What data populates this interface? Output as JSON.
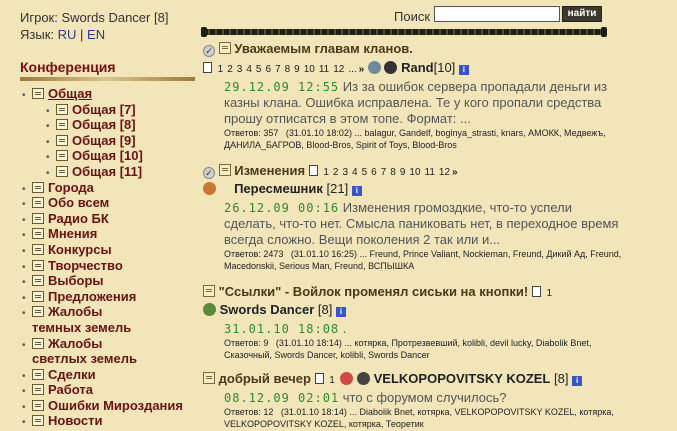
{
  "sidebar": {
    "player_label": "Игрок:",
    "player_name": "Swords Dancer",
    "player_level": "[8]",
    "lang_label": "Язык:",
    "lang_ru": "RU",
    "lang_sep": "|",
    "lang_en": "EN",
    "conference_title": "Конференция",
    "items": [
      {
        "label": "Общая"
      },
      {
        "label": "Общая [7]"
      },
      {
        "label": "Общая [8]"
      },
      {
        "label": "Общая [9]"
      },
      {
        "label": "Общая [10]"
      },
      {
        "label": "Общая [11]"
      },
      {
        "label": "Города"
      },
      {
        "label": "Обо всем"
      },
      {
        "label": "Радио БК"
      },
      {
        "label": "Мнения"
      },
      {
        "label": "Конкурсы"
      },
      {
        "label": "Творчество"
      },
      {
        "label": "Выборы"
      },
      {
        "label": "Предложения"
      },
      {
        "label": "Жалобы"
      },
      {
        "label": "темных земель"
      },
      {
        "label": "Жалобы"
      },
      {
        "label": "светлых земель"
      },
      {
        "label": "Сделки"
      },
      {
        "label": "Работа"
      },
      {
        "label": "Ошибки Мироздания"
      },
      {
        "label": "Новости"
      }
    ]
  },
  "search": {
    "label": "Поиск",
    "value": "",
    "button": "найти"
  },
  "topics": [
    {
      "title": "Уважаемым главам кланов.",
      "pages": [
        "1",
        "2",
        "3",
        "4",
        "5",
        "6",
        "7",
        "8",
        "9",
        "10",
        "11",
        "12",
        "...",
        "»"
      ],
      "author": "Rand",
      "level": "[10]",
      "date": "29.12.09 12:55",
      "excerpt": "Из за ошибок сервера пропадали деньги из казны клана. Ошибка исправлена.   Те у кого пропали средства прошу отписатся в этом топе.    Формат:   ...",
      "replies_label": "Ответов:",
      "replies": "357",
      "last_date": "(31.01.10 18:02)",
      "participants": "... balagur, Gandelf, boginya_strasti, knars, АМОКК, Медвежъ, ДАНИЛА_БАГРОВ, Blood-Bros, Spirit of Toys, Blood-Bros"
    },
    {
      "title": "Изменения",
      "pages": [
        "1",
        "2",
        "3",
        "4",
        "5",
        "6",
        "7",
        "8",
        "9",
        "10",
        "11",
        "12",
        "»"
      ],
      "author": "Пересмешник",
      "level": "[21]",
      "date": "26.12.09 00:16",
      "excerpt": "Изменения громоздкие, что-то успели сделать, что-то нет. Смысла паниковать нет, в переходное время всегда сложно. Вещи поколения 2 так или и...",
      "replies_label": "Ответов:",
      "replies": "2473",
      "last_date": "(31.01.10 16:25)",
      "participants": "... Freund, Prince Valiant, Nockieman, Freund, Дикий Ад, Freund, Macedonskii, Serious Man, Freund, ВСПЫШКА"
    },
    {
      "title": "\"Ссылки\" - Войлок променял сиськи на кнопки!",
      "pages": [
        "1"
      ],
      "author": "Swords Dancer",
      "level": "[8]",
      "date": "31.01.10 18:08",
      "excerpt": ".",
      "replies_label": "Ответов:",
      "replies": "9",
      "last_date": "(31.01.10 18:14)",
      "participants": "... котярка, Протрезвевший, kolibli, devil lucky, Diabolik Bnet, Сказочный, Swords Dancer, kolibli, Swords Dancer"
    },
    {
      "title": "добрый вечер",
      "pages": [
        "1"
      ],
      "author": "VELKOPOPOVITSKY KOZEL",
      "level": "[8]",
      "date": "08.12.09 02:01",
      "excerpt": "что с форумом случилось?",
      "replies_label": "Ответов:",
      "replies": "12",
      "last_date": "(31.01.10 18:14)",
      "participants": "... Diabolik Bnet, котярка, VELKOPOPOVITSKY KOZEL, котярка, VELKOPOPOVITSKY KOZEL, котярка, Теоретик"
    }
  ],
  "colors": {
    "background": "#f2e5b9",
    "date": "#2f8a2f",
    "sidebar_link": "#6a1313",
    "conference_title": "#7a0f0f"
  }
}
